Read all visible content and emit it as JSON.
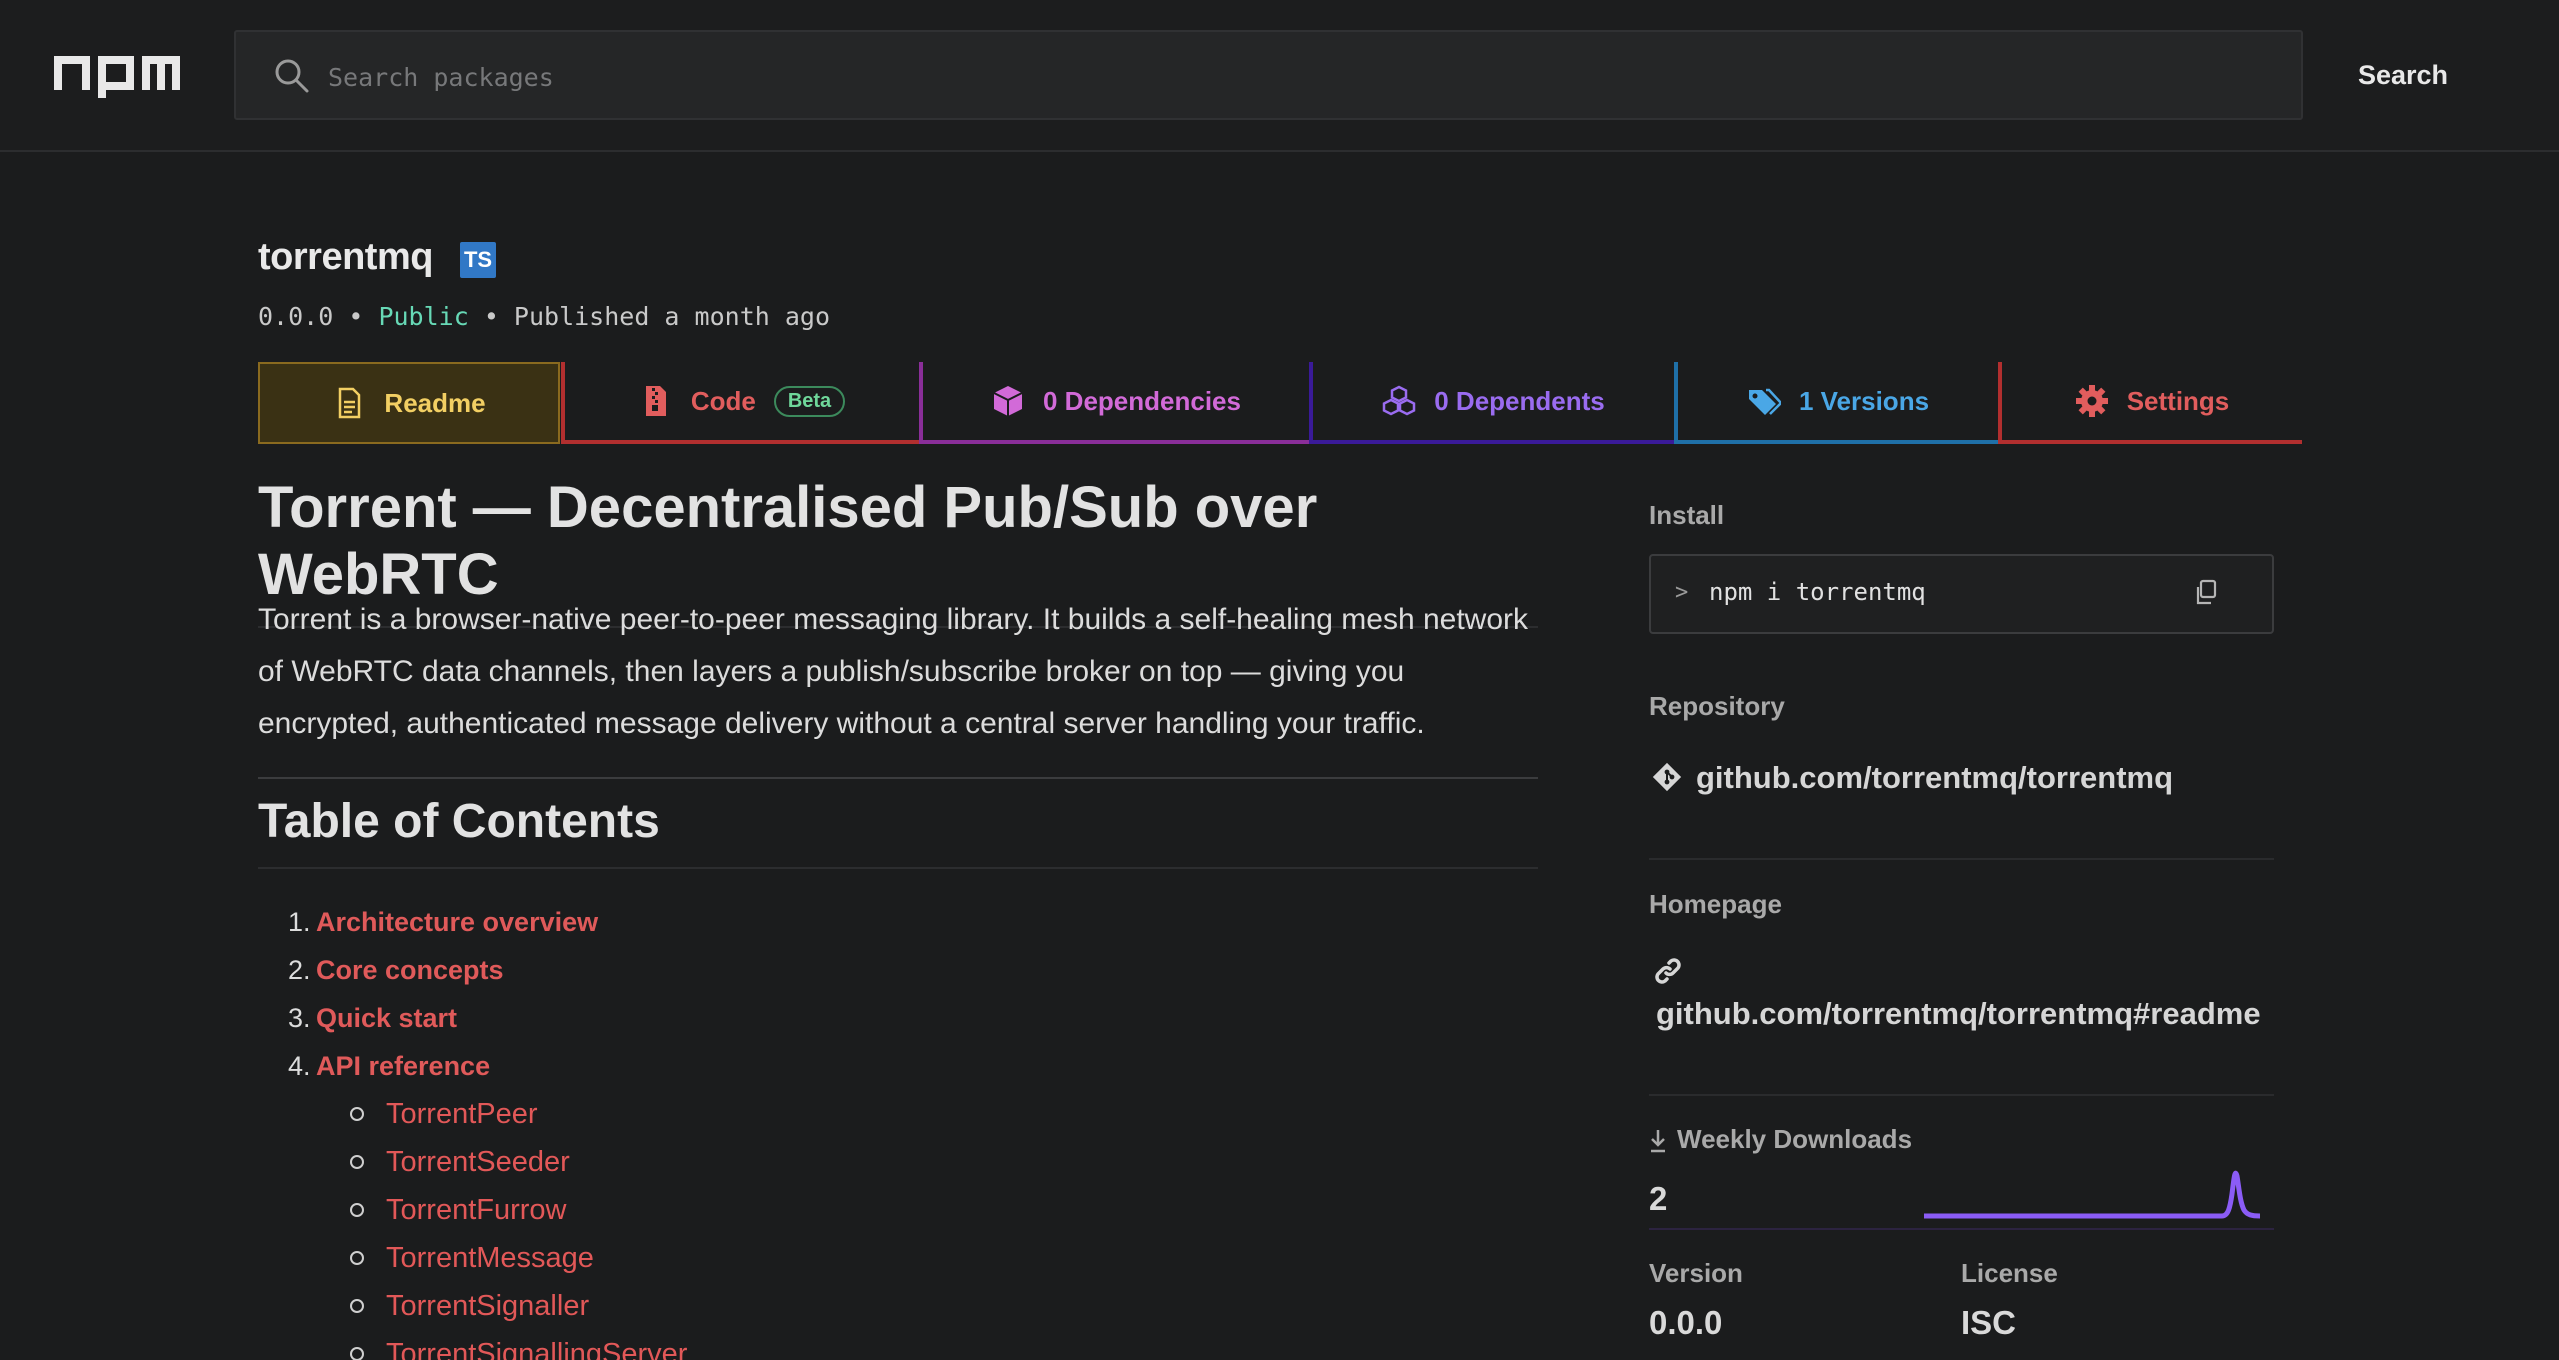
{
  "header": {
    "logo_text": "npm",
    "search_placeholder": "Search packages",
    "search_button": "Search"
  },
  "package": {
    "name": "torrentmq",
    "ts_badge": "TS",
    "version": "0.0.0",
    "visibility": "Public",
    "published": "Published a month ago"
  },
  "tabs": {
    "readme": "Readme",
    "code": "Code",
    "code_badge": "Beta",
    "dependencies": "0 Dependencies",
    "dependents": "0 Dependents",
    "versions": "1 Versions",
    "settings": "Settings"
  },
  "readme": {
    "title": "Torrent — Decentralised Pub/Sub over WebRTC",
    "intro": "Torrent is a browser-native peer-to-peer messaging library. It builds a self-healing mesh network of WebRTC data channels, then layers a publish/subscribe broker on top — giving you encrypted, authenticated message delivery without a central server handling your traffic.",
    "toc_title": "Table of Contents",
    "toc": [
      {
        "num": "1.",
        "label": "Architecture overview"
      },
      {
        "num": "2.",
        "label": "Core concepts"
      },
      {
        "num": "3.",
        "label": "Quick start"
      },
      {
        "num": "4.",
        "label": "API reference"
      }
    ],
    "toc_sub": [
      "TorrentPeer",
      "TorrentSeeder",
      "TorrentFurrow",
      "TorrentMessage",
      "TorrentSignaller",
      "TorrentSignallingServer"
    ]
  },
  "sidebar": {
    "install_label": "Install",
    "install_prompt": ">",
    "install_cmd": "npm i torrentmq",
    "repository_label": "Repository",
    "repository_link": "github.com/torrentmq/torrentmq",
    "homepage_label": "Homepage",
    "homepage_link": "github.com/torrentmq/torrentmq#readme",
    "downloads_label": "Weekly Downloads",
    "downloads_value": "2",
    "version_label": "Version",
    "version_value": "0.0.0",
    "license_label": "License",
    "license_value": "ISC"
  },
  "colors": {
    "accent": "#e05a5a",
    "sparkline": "#8b5cf6",
    "public": "#67d9b6"
  }
}
